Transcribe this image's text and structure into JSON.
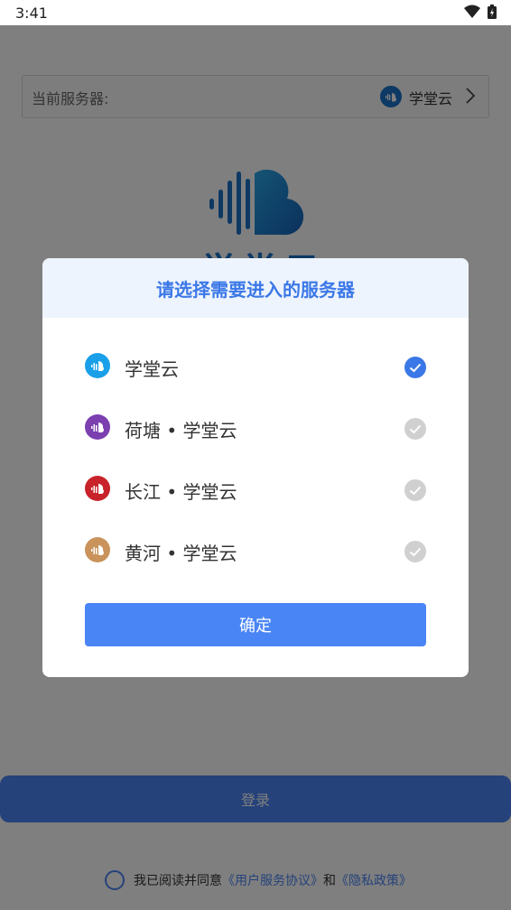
{
  "status_bar": {
    "time": "3:41"
  },
  "server_row": {
    "label": "当前服务器:",
    "value": "学堂云"
  },
  "brand": {
    "name": "学堂云"
  },
  "dialog": {
    "title": "请选择需要进入的服务器",
    "options": [
      {
        "name": "学堂云",
        "color": "#1aa0e8",
        "selected": true
      },
      {
        "name": "荷塘 • 学堂云",
        "color": "#7b3fb0",
        "selected": false
      },
      {
        "name": "长江 • 学堂云",
        "color": "#c8232a",
        "selected": false
      },
      {
        "name": "黄河 • 学堂云",
        "color": "#c9935b",
        "selected": false
      }
    ],
    "confirm_label": "确定"
  },
  "login": {
    "button_label": "登录"
  },
  "agreement": {
    "prefix": "我已阅读并同意",
    "terms": "《用户服务协议》",
    "and": "和",
    "privacy": "《隐私政策》"
  },
  "colors": {
    "accent": "#4a85f5",
    "checked": "#3b78e7",
    "unchecked": "#d0d0d0"
  }
}
